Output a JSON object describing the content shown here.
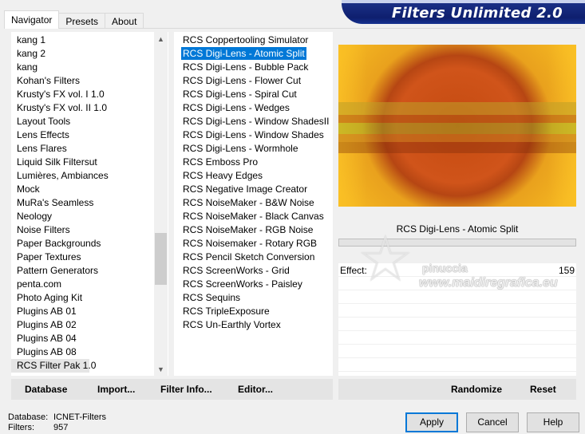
{
  "tabs": [
    "Navigator",
    "Presets",
    "About"
  ],
  "banner": "Filters Unlimited 2.0",
  "categories": [
    "kang 1",
    "kang 2",
    "kang",
    "Kohan's Filters",
    "Krusty's FX vol. I 1.0",
    "Krusty's FX vol. II 1.0",
    "Layout Tools",
    "Lens Effects",
    "Lens Flares",
    "Liquid Silk Filtersut",
    "Lumières, Ambiances",
    "Mock",
    "MuRa's Seamless",
    "Neology",
    "Noise Filters",
    "Paper Backgrounds",
    "Paper Textures",
    "Pattern Generators",
    "penta.com",
    "Photo Aging Kit",
    "Plugins AB 01",
    "Plugins AB 02",
    "Plugins AB 04",
    "Plugins AB 08",
    "RCS Filter Pak 1.0"
  ],
  "selected_category": "RCS Filter Pak 1.0",
  "filters": [
    "RCS Coppertooling Simulator",
    "RCS Digi-Lens - Atomic Split",
    "RCS Digi-Lens - Bubble Pack",
    "RCS Digi-Lens - Flower Cut",
    "RCS Digi-Lens - Spiral Cut",
    "RCS Digi-Lens - Wedges",
    "RCS Digi-Lens - Window ShadesII",
    "RCS Digi-Lens - Window Shades",
    "RCS Digi-Lens - Wormhole",
    "RCS Emboss Pro",
    "RCS Heavy Edges",
    "RCS Negative Image Creator",
    "RCS NoiseMaker - B&W Noise",
    "RCS NoiseMaker - Black Canvas",
    "RCS NoiseMaker - RGB Noise",
    "RCS Noisemaker - Rotary RGB",
    "RCS Pencil Sketch Conversion",
    "RCS ScreenWorks - Grid",
    "RCS ScreenWorks - Paisley",
    "RCS Sequins",
    "RCS TripleExposure",
    "RCS Un-Earthly Vortex"
  ],
  "selected_filter": "RCS Digi-Lens - Atomic Split",
  "preview_filter_name": "RCS Digi-Lens - Atomic Split",
  "params": [
    {
      "label": "Effect:",
      "value": "159"
    }
  ],
  "left_buttons": {
    "database": "Database",
    "import": "Import...",
    "filter_info": "Filter Info...",
    "editor": "Editor..."
  },
  "right_buttons": {
    "randomize": "Randomize",
    "reset": "Reset"
  },
  "info": {
    "database_label": "Database:",
    "database_value": "ICNET-Filters",
    "filters_label": "Filters:",
    "filters_value": "957"
  },
  "dialog_buttons": {
    "apply": "Apply",
    "cancel": "Cancel",
    "help": "Help"
  },
  "watermark": {
    "name": "pinuccia",
    "site": "www.maidiregrafica.eu"
  },
  "colors": {
    "selection": "#0078d7",
    "banner": "#0e1f6e"
  }
}
